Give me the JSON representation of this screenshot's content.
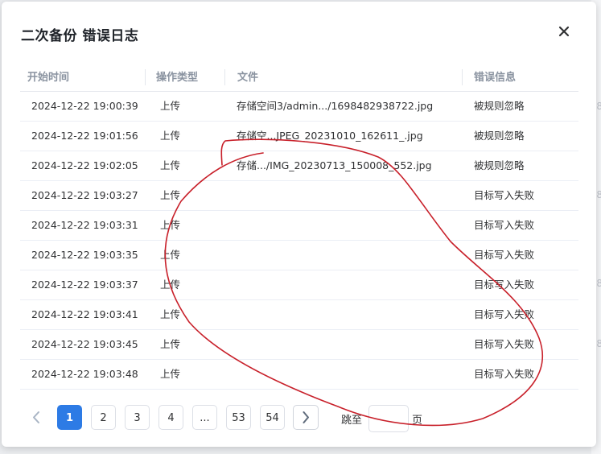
{
  "dialog": {
    "title": "二次备份 错误日志",
    "close_icon": "close-icon"
  },
  "table": {
    "headers": [
      "开始时间",
      "操作类型",
      "文件",
      "错误信息"
    ],
    "rows": [
      {
        "time": "2024-12-22 19:00:39",
        "op": "上传",
        "file": "存储空间3/admin.../1698482938722.jpg",
        "error": "被规则忽略"
      },
      {
        "time": "2024-12-22 19:01:56",
        "op": "上传",
        "file": "存储空...JPEG_20231010_162611_.jpg",
        "error": "被规则忽略"
      },
      {
        "time": "2024-12-22 19:02:05",
        "op": "上传",
        "file": "存储.../IMG_20230713_150008_552.jpg",
        "error": "被规则忽略"
      },
      {
        "time": "2024-12-22 19:03:27",
        "op": "上传",
        "file": "",
        "error": "目标写入失败"
      },
      {
        "time": "2024-12-22 19:03:31",
        "op": "上传",
        "file": "",
        "error": "目标写入失败"
      },
      {
        "time": "2024-12-22 19:03:35",
        "op": "上传",
        "file": "",
        "error": "目标写入失败"
      },
      {
        "time": "2024-12-22 19:03:37",
        "op": "上传",
        "file": "",
        "error": "目标写入失败"
      },
      {
        "time": "2024-12-22 19:03:41",
        "op": "上传",
        "file": "",
        "error": "目标写入失败"
      },
      {
        "time": "2024-12-22 19:03:45",
        "op": "上传",
        "file": "",
        "error": "目标写入失败"
      },
      {
        "time": "2024-12-22 19:03:48",
        "op": "上传",
        "file": "",
        "error": "目标写入失败"
      }
    ]
  },
  "pagination": {
    "current_page": "1",
    "pages": [
      "1",
      "2",
      "3",
      "4",
      "...",
      "53",
      "54"
    ],
    "jump_label": "跳至",
    "jump_suffix": "页",
    "jump_value": "",
    "prev_icon": "chevron-left-icon",
    "next_icon": "chevron-right-icon"
  },
  "colors": {
    "accent": "#2d7be5",
    "annotation": "#c8202a"
  }
}
